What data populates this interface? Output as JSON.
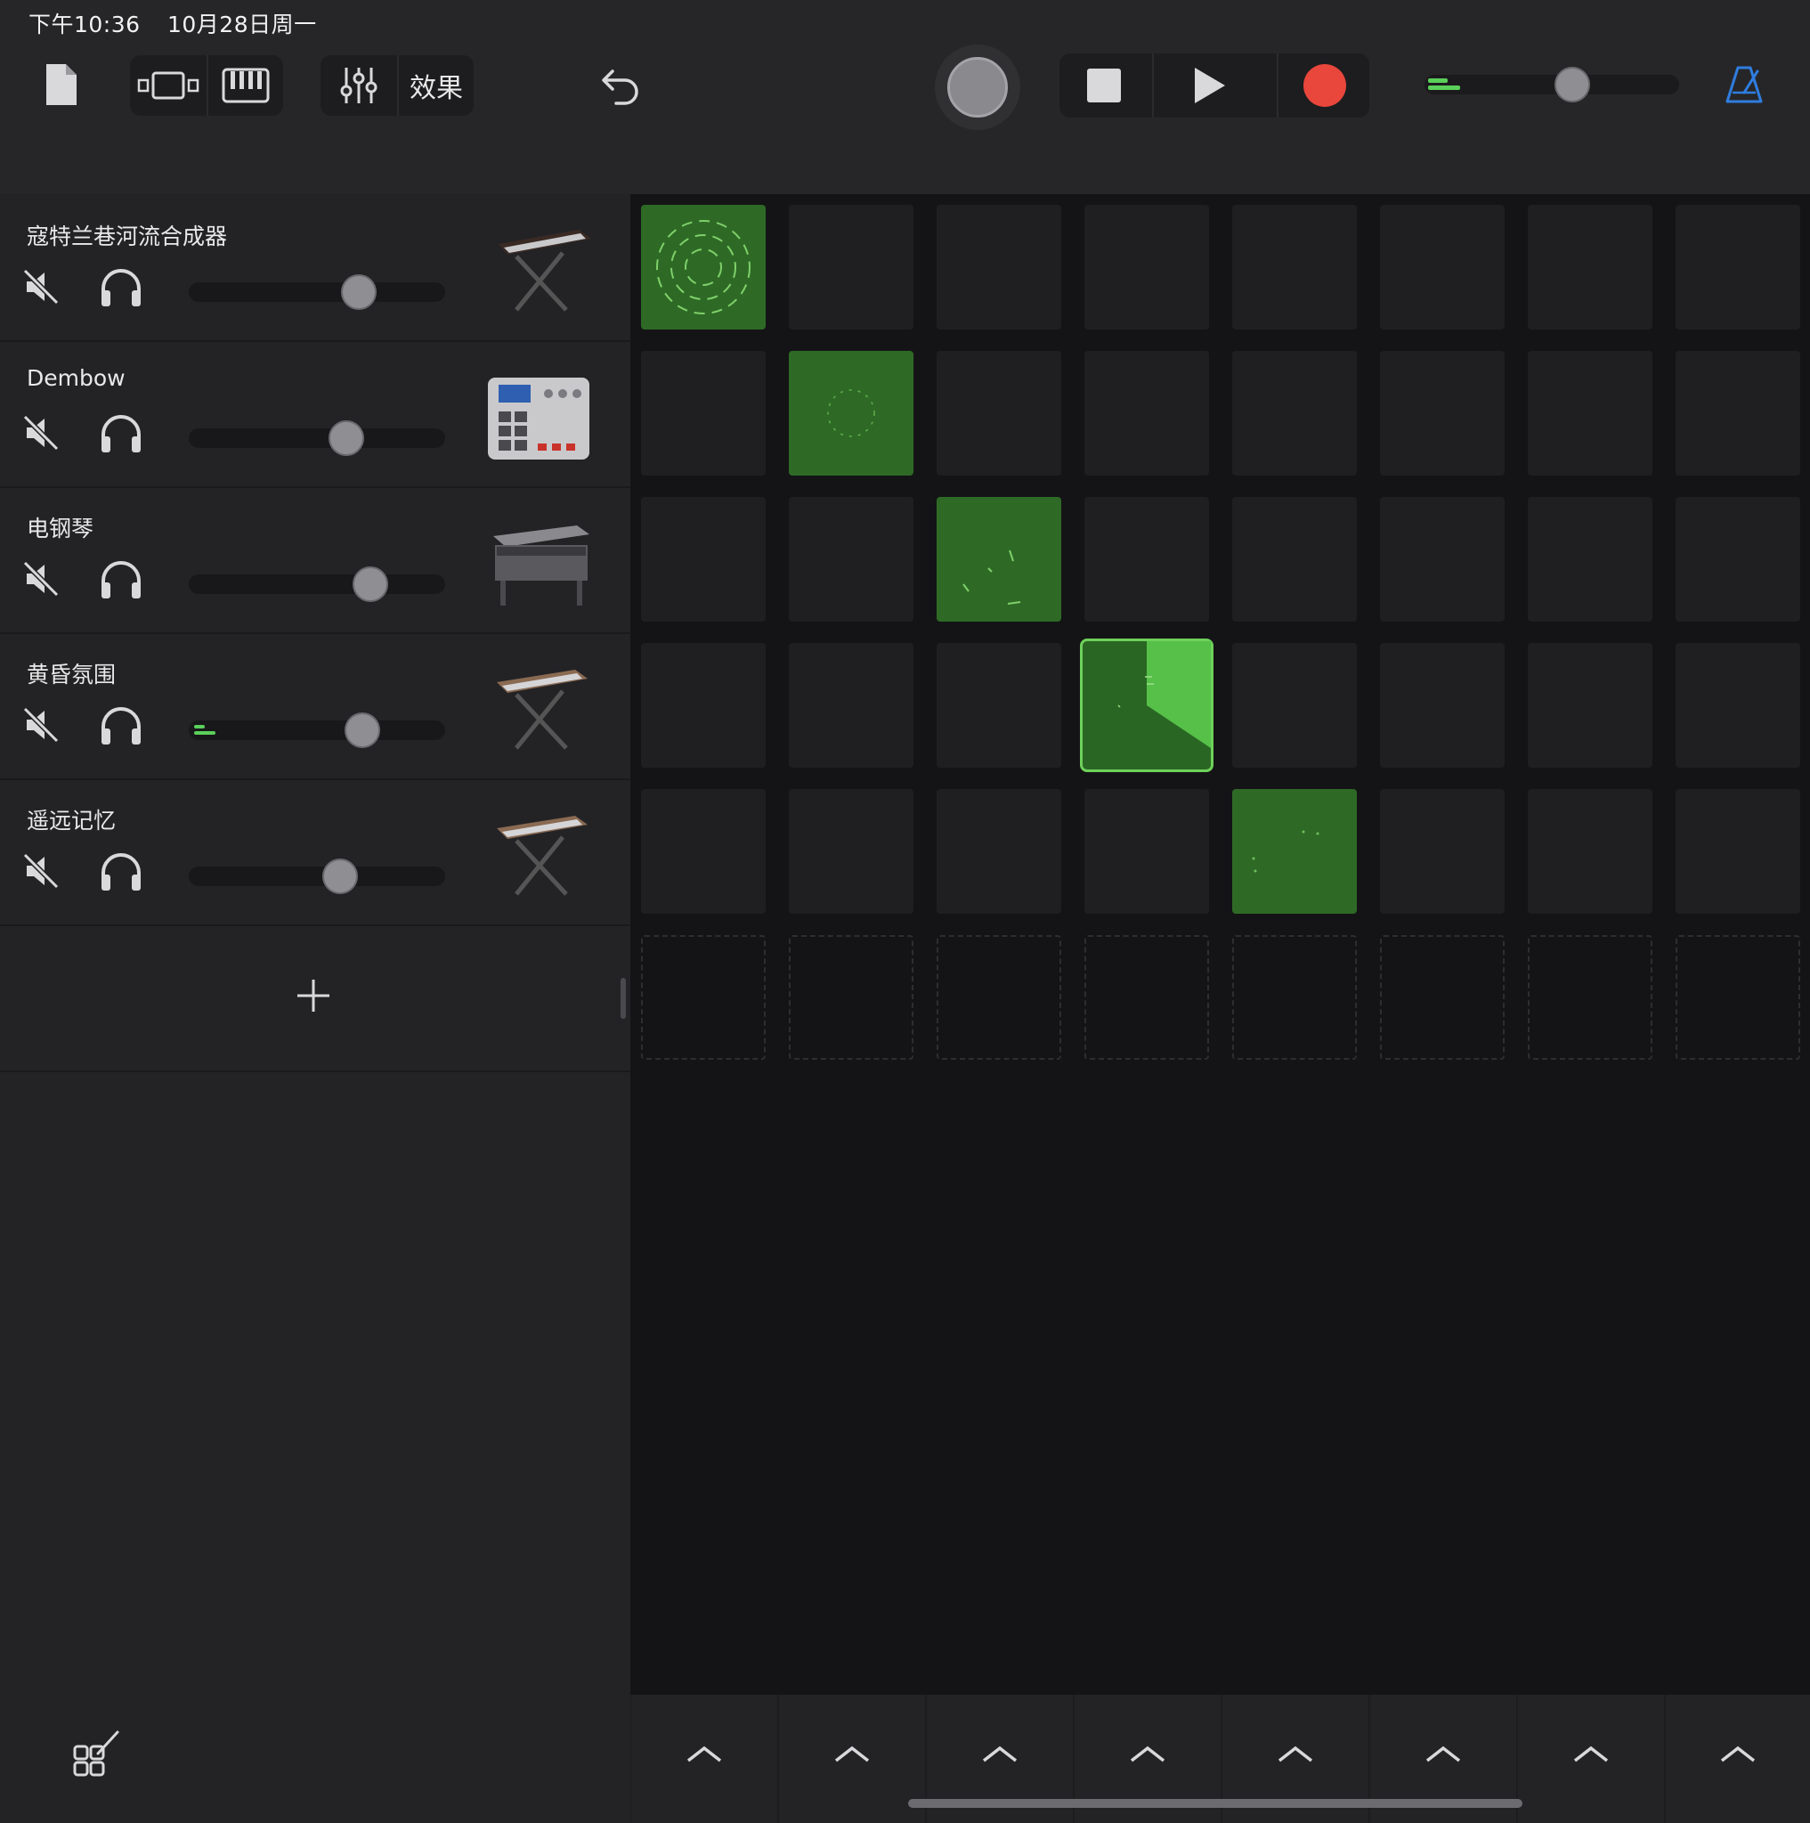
{
  "status_bar": {
    "time": "下午10:36",
    "date": "10月28日周一"
  },
  "toolbar": {
    "fx_label": "效果",
    "accent_color": "#2f7de0",
    "record_color": "#e9463c",
    "icons": [
      "document-icon",
      "view-toggle-icon",
      "keyboard-icon",
      "mixer-icon",
      "undo-icon",
      "master-knob-icon",
      "stop-icon",
      "play-icon",
      "record-icon",
      "master-volume-icon",
      "metronome-icon"
    ]
  },
  "tracks": [
    {
      "name": "寇特兰巷河流合成器",
      "volume": 0.68,
      "instrument": "synth-keyboard-on-stand"
    },
    {
      "name": "Dembow",
      "volume": 0.63,
      "instrument": "drum-machine"
    },
    {
      "name": "电钢琴",
      "volume": 0.72,
      "instrument": "electric-piano"
    },
    {
      "name": "黄昏氛围",
      "volume": 0.7,
      "instrument": "synth-keyboard-on-stand"
    },
    {
      "name": "遥远记忆",
      "volume": 0.6,
      "instrument": "synth-keyboard-on-stand"
    }
  ],
  "grid": {
    "columns": 8,
    "active_cells": [
      [
        0,
        0
      ],
      [
        1,
        1
      ],
      [
        2,
        2
      ],
      [
        3,
        3
      ],
      [
        4,
        4
      ]
    ],
    "playing_cell": [
      3,
      3
    ],
    "active_color": "#2e6a26",
    "playing_color": "#56c048"
  },
  "add_track_label": "+"
}
